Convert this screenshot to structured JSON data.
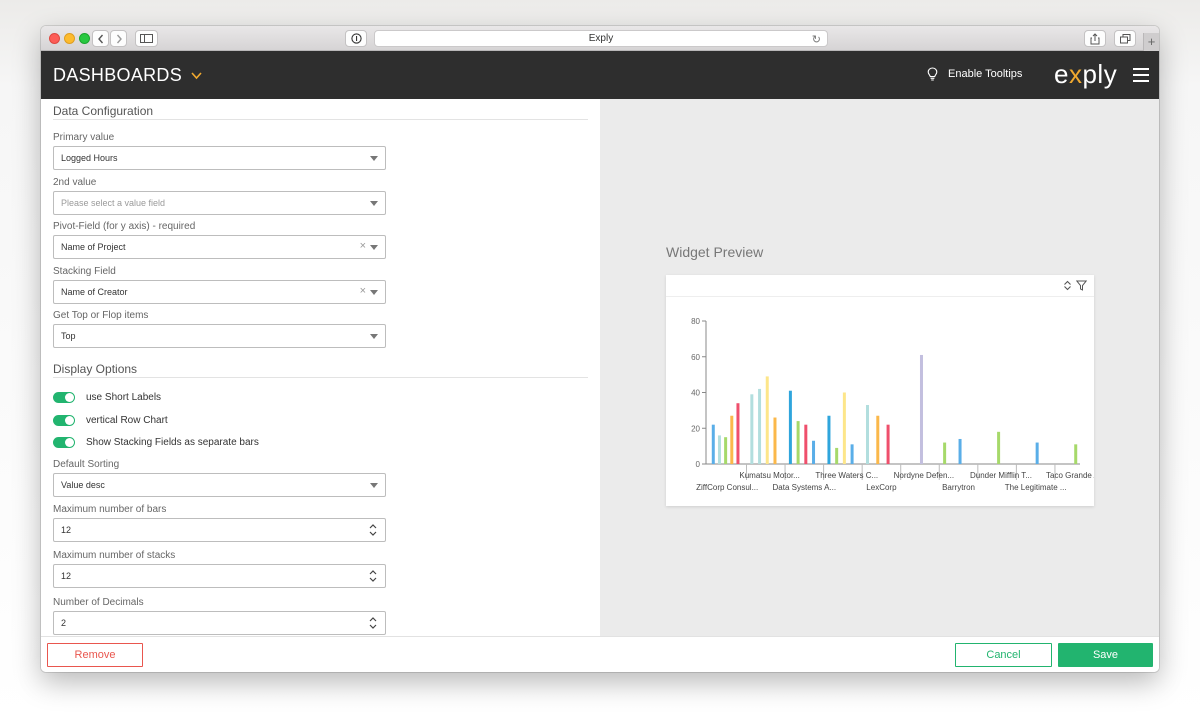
{
  "browser": {
    "tab_title": "Exply"
  },
  "header": {
    "title": "DASHBOARDS",
    "tooltips_label": "Enable Tooltips",
    "logo_prefix": "e",
    "logo_x": "x",
    "logo_suffix": "ply"
  },
  "config": {
    "data_section": "Data Configuration",
    "primary_label": "Primary value",
    "primary_value": "Logged Hours",
    "second_label": "2nd value",
    "second_placeholder": "Please select a value field",
    "pivot_label": "Pivot-Field (for y axis) - required",
    "pivot_value": "Name of Project",
    "stacking_label": "Stacking Field",
    "stacking_value": "Name of Creator",
    "topflop_label": "Get Top or Flop items",
    "topflop_value": "Top",
    "display_section": "Display Options",
    "toggles": [
      {
        "label": "use Short Labels",
        "on": true
      },
      {
        "label": "vertical Row Chart",
        "on": true
      },
      {
        "label": "Show Stacking Fields as separate bars",
        "on": true
      }
    ],
    "sorting_label": "Default Sorting",
    "sorting_value": "Value desc",
    "max_bars_label": "Maximum number of bars",
    "max_bars_value": "12",
    "max_stacks_label": "Maximum number of stacks",
    "max_stacks_value": "12",
    "decimals_label": "Number of Decimals",
    "decimals_value": "2"
  },
  "preview": {
    "title": "Widget Preview"
  },
  "footer": {
    "remove": "Remove",
    "cancel": "Cancel",
    "save": "Save"
  },
  "colors": {
    "accent_green": "#22b46f",
    "remove_red": "#e9564e",
    "header_bg": "#2e2e2e",
    "logo_accent": "#f0a92f"
  },
  "chart_data": {
    "type": "bar",
    "ylim": [
      0,
      80
    ],
    "yticks": [
      0,
      20,
      40,
      60,
      80
    ],
    "categories": [
      "ZiffCorp Consul...",
      "Kumatsu Motor...",
      "Data Systems A...",
      "Three Waters C...",
      "LexCorp",
      "Nordyne Defen...",
      "Barrytron",
      "Dunder Mifflin T...",
      "The Legitimate ...",
      "Taco Grande Ap..."
    ],
    "bars": [
      {
        "cat": 0,
        "color": "#5aaee8",
        "value": 22
      },
      {
        "cat": 0,
        "color": "#b2dede",
        "value": 16
      },
      {
        "cat": 0,
        "color": "#a6d96a",
        "value": 15
      },
      {
        "cat": 0,
        "color": "#fbb84a",
        "value": 27
      },
      {
        "cat": 0,
        "color": "#ef4f6c",
        "value": 34
      },
      {
        "cat": 1,
        "color": "#b2dede",
        "value": 39
      },
      {
        "cat": 1,
        "color": "#b2dede",
        "value": 42
      },
      {
        "cat": 1,
        "color": "#fde68a",
        "value": 49
      },
      {
        "cat": 1,
        "color": "#fbb84a",
        "value": 26
      },
      {
        "cat": 2,
        "color": "#2fa5dc",
        "value": 41
      },
      {
        "cat": 2,
        "color": "#a6d96a",
        "value": 24
      },
      {
        "cat": 2,
        "color": "#ef4f6c",
        "value": 22
      },
      {
        "cat": 2,
        "color": "#5aaee8",
        "value": 13
      },
      {
        "cat": 3,
        "color": "#2fa5dc",
        "value": 27
      },
      {
        "cat": 3,
        "color": "#a6d96a",
        "value": 9
      },
      {
        "cat": 3,
        "color": "#fde68a",
        "value": 40
      },
      {
        "cat": 3,
        "color": "#5aaee8",
        "value": 11
      },
      {
        "cat": 4,
        "color": "#b2dede",
        "value": 33
      },
      {
        "cat": 4,
        "color": "#fbb84a",
        "value": 27
      },
      {
        "cat": 4,
        "color": "#ef4f6c",
        "value": 22
      },
      {
        "cat": 5,
        "color": "#c3bfdf",
        "value": 61
      },
      {
        "cat": 6,
        "color": "#a6d96a",
        "value": 12
      },
      {
        "cat": 6,
        "color": "#5aaee8",
        "value": 14
      },
      {
        "cat": 7,
        "color": "#a6d96a",
        "value": 18
      },
      {
        "cat": 8,
        "color": "#5aaee8",
        "value": 12
      },
      {
        "cat": 9,
        "color": "#a6d96a",
        "value": 11
      }
    ]
  }
}
